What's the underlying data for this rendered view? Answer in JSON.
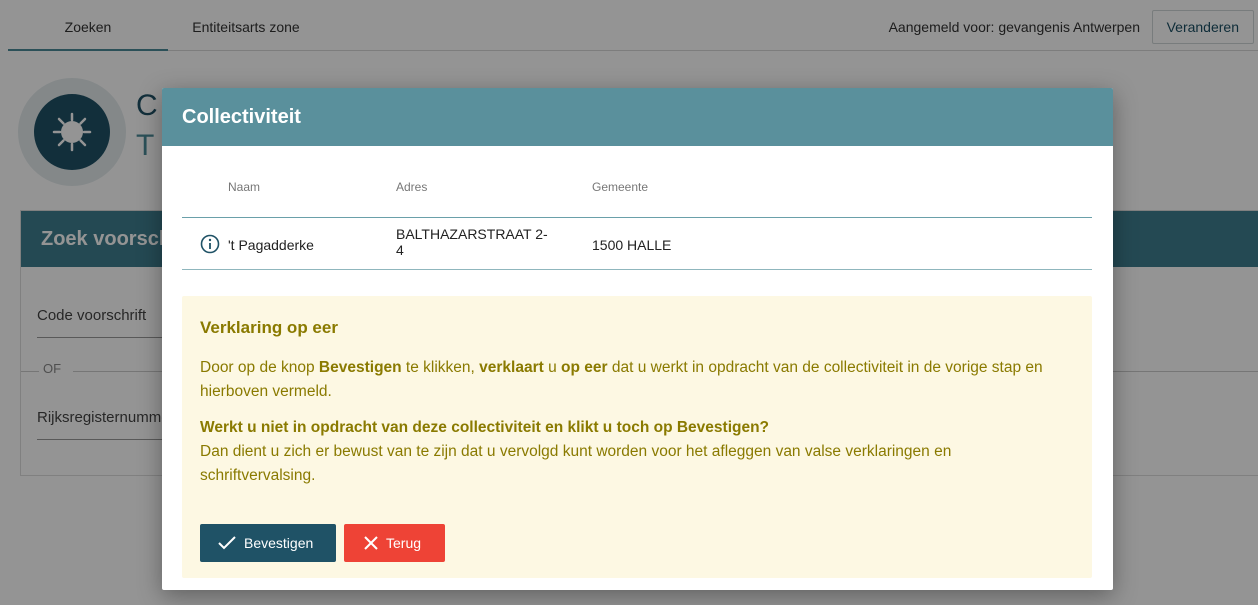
{
  "topbar": {
    "tabs": [
      "Zoeken",
      "Entiteitsarts zone"
    ],
    "login_text": "Aangemeld voor: gevangenis Antwerpen",
    "change_label": "Veranderen"
  },
  "hero": {
    "title": "C",
    "subtitle": "T"
  },
  "search": {
    "header": "Zoek voorschrift",
    "code_label": "Code voorschrift",
    "or_label": "OF",
    "rrn_label": "Rijksregisternummer"
  },
  "modal": {
    "title": "Collectiviteit",
    "columns": [
      "Naam",
      "Adres",
      "Gemeente"
    ],
    "row": {
      "name": "'t Pagadderke",
      "address_line1": "BALTHAZARSTRAAT 2-",
      "address_line2": "4",
      "municipality": "1500 HALLE"
    },
    "notice": {
      "title": "Verklaring op eer",
      "p1_a": "Door op de knop ",
      "p1_b": "Bevestigen",
      "p1_c": " te klikken, ",
      "p1_d": "verklaart",
      "p1_e": " u ",
      "p1_f": "op eer",
      "p1_g": " dat u werkt in opdracht van de collectiviteit in de vorige stap en hierboven vermeld.",
      "question": "Werkt u niet in opdracht van deze collectiviteit en klikt u toch op Bevestigen?",
      "warning": "Dan dient u zich er bewust van te zijn dat u vervolgd kunt worden voor het afleggen van valse verklaringen en schriftvervalsing."
    },
    "confirm_label": "Bevestigen",
    "back_label": "Terug"
  },
  "colors": {
    "accent": "#5a909c",
    "primary": "#1f5266",
    "danger": "#ee4336",
    "notice_bg": "#fdf8e3",
    "notice_text": "#8a7a00"
  },
  "icons": [
    "virus-icon",
    "info-icon",
    "check-icon",
    "close-icon"
  ]
}
